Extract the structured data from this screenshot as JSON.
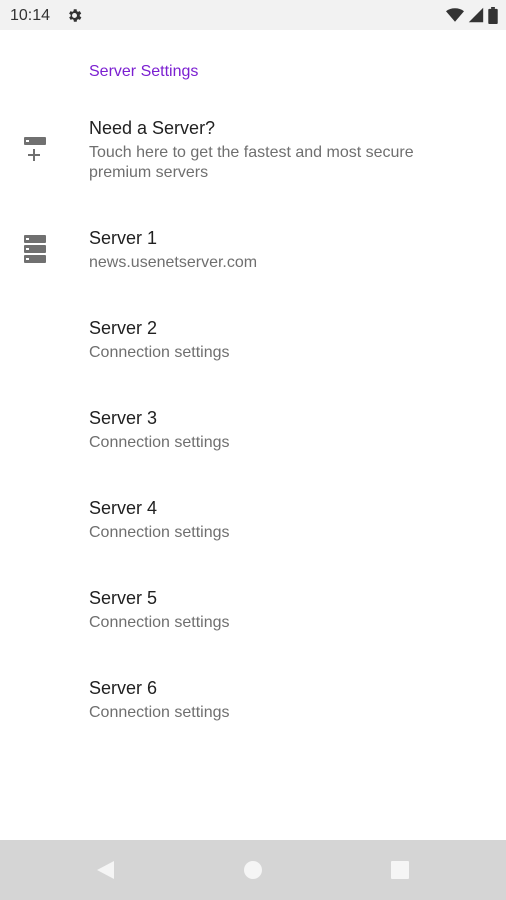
{
  "status_bar": {
    "time": "10:14",
    "left_icons": [
      "gear-icon"
    ],
    "right_icons": [
      "wifi-icon",
      "signal-icon",
      "battery-icon"
    ]
  },
  "section": {
    "header": "Server Settings",
    "accent_color": "#7b1fd1"
  },
  "items": [
    {
      "title": "Need a Server?",
      "summary": "Touch here to get the fastest and most secure premium servers",
      "icon": "add-server-icon"
    },
    {
      "title": "Server 1",
      "summary": "news.usenetserver.com",
      "icon": "server-stack-icon"
    },
    {
      "title": "Server 2",
      "summary": "Connection settings",
      "icon": ""
    },
    {
      "title": "Server 3",
      "summary": "Connection settings",
      "icon": ""
    },
    {
      "title": "Server 4",
      "summary": "Connection settings",
      "icon": ""
    },
    {
      "title": "Server 5",
      "summary": "Connection settings",
      "icon": ""
    },
    {
      "title": "Server 6",
      "summary": "Connection settings",
      "icon": ""
    }
  ],
  "nav_bar": {
    "buttons": [
      "back-icon",
      "home-icon",
      "recents-icon"
    ]
  }
}
